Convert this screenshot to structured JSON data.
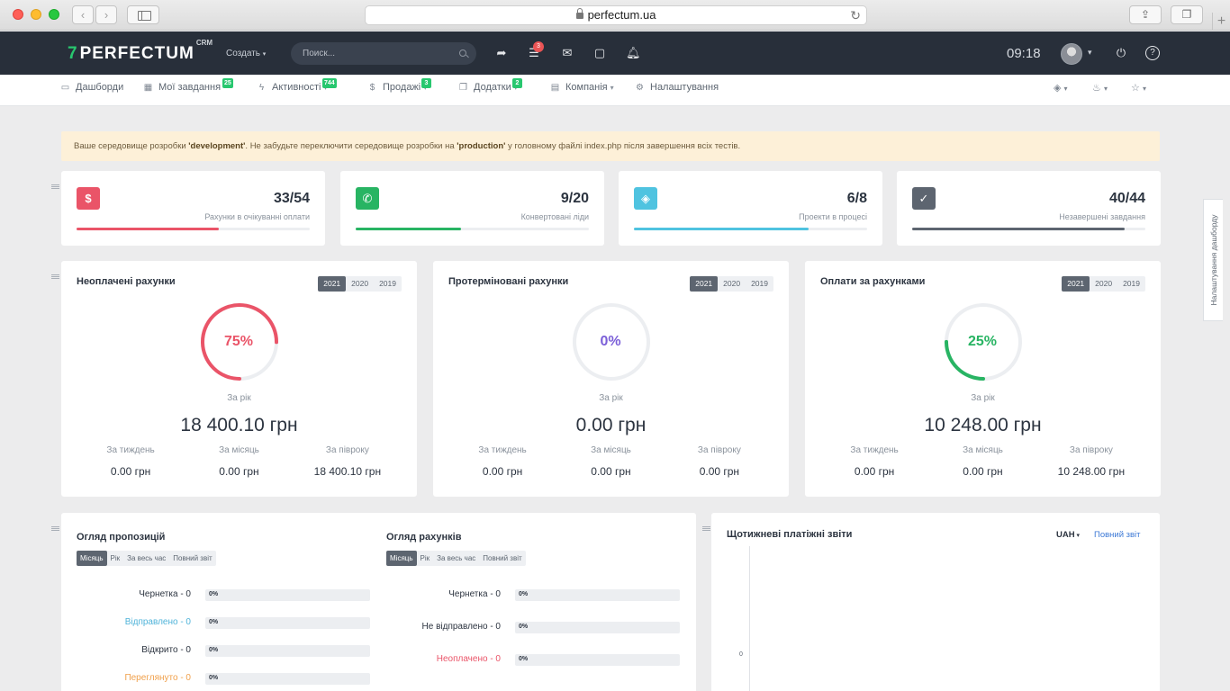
{
  "browser": {
    "url": "perfectum.ua"
  },
  "app": {
    "logo_text": "PERFECTUM",
    "logo_suffix": "CRM",
    "create_label": "Создать",
    "search_placeholder": "Поиск...",
    "messages_badge": "3",
    "clock": "09:18"
  },
  "nav": {
    "items": [
      {
        "label": "Дашборди"
      },
      {
        "label": "Мої завдання",
        "badge": "25"
      },
      {
        "label": "Активності",
        "badge": "744"
      },
      {
        "label": "Продажі",
        "badge": "3"
      },
      {
        "label": "Додатки",
        "badge": "2"
      },
      {
        "label": "Компанія"
      },
      {
        "label": "Налаштування"
      }
    ]
  },
  "alert": {
    "part1": "Ваше середовище розробки ",
    "env1": "'development'",
    "part2": ". Не забудьте переключити середовище розробки на ",
    "env2": "'production'",
    "part3": " у головному файлі index.php після завершення всіх тестів."
  },
  "stats": [
    {
      "value": "33/54",
      "label": "Рахунки в очікуванні оплати",
      "progress": 0.61,
      "color": "#ea5468",
      "icon": "dollar-icon"
    },
    {
      "value": "9/20",
      "label": "Конвертовані ліди",
      "progress": 0.45,
      "color": "#28b463",
      "icon": "phone-icon"
    },
    {
      "value": "6/8",
      "label": "Проекти в процесі",
      "progress": 0.75,
      "color": "#4fc3e0",
      "icon": "layers-icon"
    },
    {
      "value": "40/44",
      "label": "Незавершені завдання",
      "progress": 0.91,
      "color": "#5d6570",
      "icon": "check-icon"
    }
  ],
  "invoices": [
    {
      "title": "Неоплачені рахунки",
      "years": [
        "2021",
        "2020",
        "2019"
      ],
      "percent": "75%",
      "percent_value": 0.75,
      "color": "#ea5468",
      "period": "За рік",
      "amount": "18 400.10 грн",
      "cols": [
        {
          "label": "За тиждень",
          "value": "0.00 грн"
        },
        {
          "label": "За місяць",
          "value": "0.00 грн"
        },
        {
          "label": "За півроку",
          "value": "18 400.10 грн"
        }
      ]
    },
    {
      "title": "Протерміновані рахунки",
      "years": [
        "2021",
        "2020",
        "2019"
      ],
      "percent": "0%",
      "percent_value": 0,
      "color": "#7b5fd8",
      "period": "За рік",
      "amount": "0.00 грн",
      "cols": [
        {
          "label": "За тиждень",
          "value": "0.00 грн"
        },
        {
          "label": "За місяць",
          "value": "0.00 грн"
        },
        {
          "label": "За півроку",
          "value": "0.00 грн"
        }
      ]
    },
    {
      "title": "Оплати за рахунками",
      "years": [
        "2021",
        "2020",
        "2019"
      ],
      "percent": "25%",
      "percent_value": 0.25,
      "color": "#28b463",
      "period": "За рік",
      "amount": "10 248.00 грн",
      "cols": [
        {
          "label": "За тиждень",
          "value": "0.00 грн"
        },
        {
          "label": "За місяць",
          "value": "0.00 грн"
        },
        {
          "label": "За півроку",
          "value": "10 248.00 грн"
        }
      ]
    }
  ],
  "proposals": {
    "title": "Огляд пропозицій",
    "tabs": [
      "Місяць",
      "Рік",
      "За весь час",
      "Повний звіт"
    ],
    "rows": [
      {
        "label": "Чернетка - 0",
        "value": "0%",
        "color": "#2c3440"
      },
      {
        "label": "Відправлено - 0",
        "value": "0%",
        "color": "#4fb3d9"
      },
      {
        "label": "Відкрито - 0",
        "value": "0%",
        "color": "#2c3440"
      },
      {
        "label": "Переглянуто - 0",
        "value": "0%",
        "color": "#f0a04b"
      }
    ]
  },
  "invoice_overview": {
    "title": "Огляд рахунків",
    "tabs": [
      "Місяць",
      "Рік",
      "За весь час",
      "Повний звіт"
    ],
    "rows": [
      {
        "label": "Чернетка - 0",
        "value": "0%",
        "color": "#2c3440"
      },
      {
        "label": "Не відправлено - 0",
        "value": "0%",
        "color": "#2c3440"
      },
      {
        "label": "Неоплачено - 0",
        "value": "0%",
        "color": "#ea5468"
      }
    ]
  },
  "weekly": {
    "title": "Щотижневі платіжні звіти",
    "currency": "UAH",
    "full_report": "Повний звіт",
    "zero": "0"
  },
  "side_tab": "Налаштування дашборду"
}
